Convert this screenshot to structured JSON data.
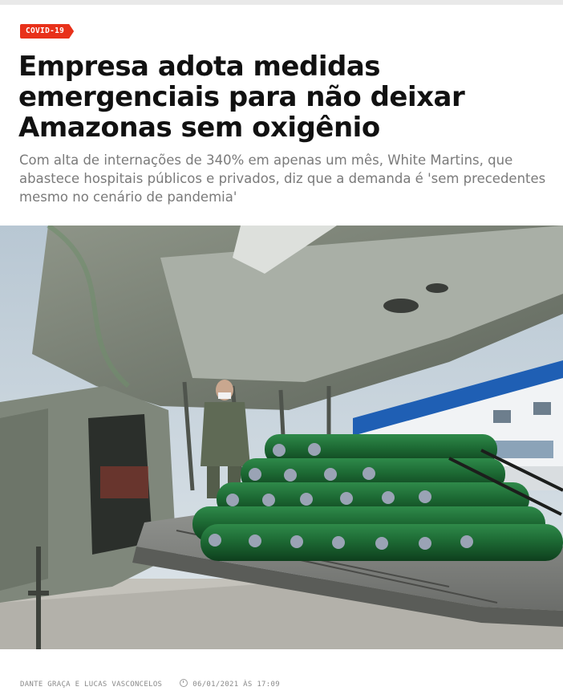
{
  "article": {
    "category": "COVID-19",
    "headline": "Empresa adota medidas emergenciais para não deixar Amazonas sem oxigênio",
    "subtitle": "Com alta de internações de 340% em apenas um mês, White Martins, que abastece hospitais públicos e privados, diz que a demanda é 'sem precedentes mesmo no cenário de pandemia'",
    "authors": "DANTE GRAÇA E LUCAS VASCONCELOS",
    "date": "06/01/2021 ÀS 17:09"
  },
  "colors": {
    "accent": "#e8311a",
    "headline": "#111111",
    "subtitle": "#7a7a7a",
    "meta": "#8a8a8a"
  },
  "icons": {
    "date": "clock-icon"
  }
}
